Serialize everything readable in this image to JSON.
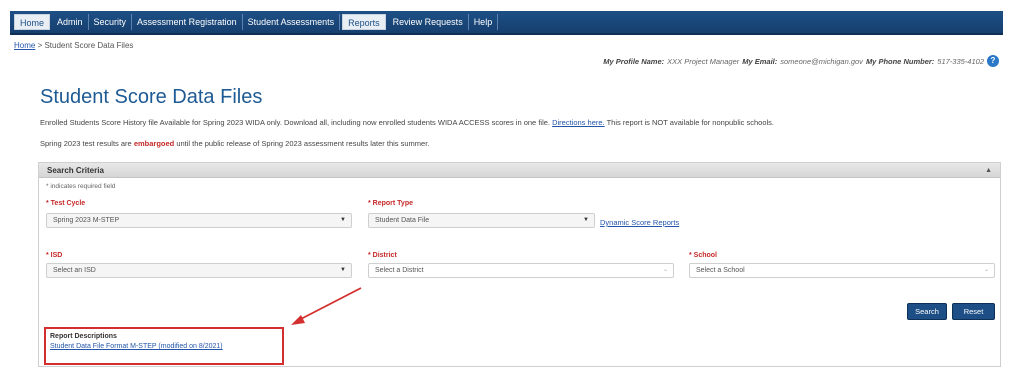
{
  "nav": {
    "items": [
      {
        "label": "Home",
        "active": true
      },
      {
        "label": "Admin",
        "active": false
      },
      {
        "label": "Security",
        "active": false
      },
      {
        "label": "Assessment Registration",
        "active": false
      },
      {
        "label": "Student Assessments",
        "active": false
      },
      {
        "label": "Reports",
        "active": true
      },
      {
        "label": "Review Requests",
        "active": false
      },
      {
        "label": "Help",
        "active": false
      }
    ]
  },
  "breadcrumb": {
    "home": "Home",
    "separator": " > ",
    "current": "Student Score Data Files"
  },
  "profile": {
    "name_label": "My Profile Name:",
    "name_value": "XXX Project Manager",
    "email_label": "My Email:",
    "email_value": "someone@michigan.gov",
    "phone_label": "My Phone Number:",
    "phone_value": "517-335-4102",
    "help_icon": "help-icon"
  },
  "page": {
    "title": "Student Score Data Files",
    "info1_text": "Enrolled Students Score History file Available for Spring 2023 WIDA only. Download all, including now enrolled students WIDA ACCESS scores in one file.",
    "info1_link": "Directions here.",
    "info1_tail": "This report is NOT available for nonpublic schools.",
    "info2_pre": "Spring 2023 test results are",
    "info2_emph": "embargoed",
    "info2_post": "until the public release of Spring 2023 assessment results later this summer."
  },
  "criteria": {
    "title": "Search Criteria",
    "required_note": "* indicates required field",
    "test_cycle_label": "* Test Cycle",
    "test_cycle_value": "Spring 2023 M-STEP",
    "report_type_label": "* Report Type",
    "report_type_value": "Student Data File",
    "dynamic_link": "Dynamic Score Reports",
    "isd_label": "* ISD",
    "isd_value": "Select an ISD",
    "district_label": "* District",
    "district_value": "Select a District",
    "school_label": "* School",
    "school_value": "Select a School",
    "search_button": "Search",
    "reset_button": "Reset",
    "report_desc_title": "Report Descriptions",
    "report_desc_link": "Student Data File Format M-STEP (modified on 8/2021)"
  },
  "colors": {
    "nav_bg": "#1d4f86",
    "title": "#1e5a93",
    "required": "#c62828",
    "highlight": "#d32f2f"
  }
}
